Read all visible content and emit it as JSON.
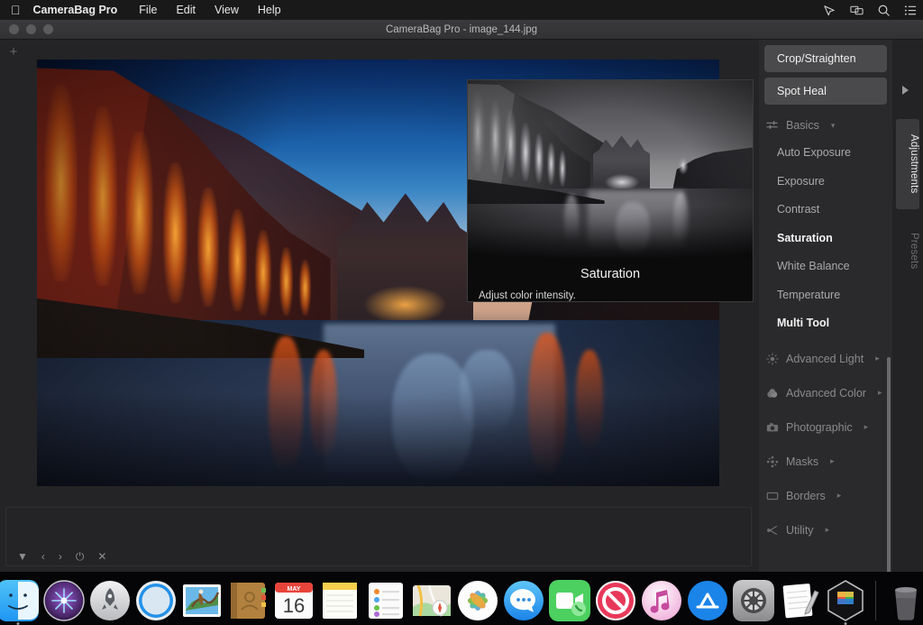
{
  "menubar": {
    "apple_icon": "apple-logo-icon",
    "app_name": "CameraBag Pro",
    "items": [
      "File",
      "Edit",
      "View",
      "Help"
    ],
    "status_icons": [
      "pointer-icon",
      "screen-sharing-icon",
      "search-icon",
      "control-center-icon"
    ]
  },
  "window": {
    "title": "CameraBag Pro - image_144.jpg",
    "traffic_lights": [
      "close",
      "minimize",
      "zoom"
    ]
  },
  "workspace": {
    "add_label": "+",
    "image_name": "image_144.jpg"
  },
  "filmstrip": {
    "tools": [
      {
        "name": "dropdown-toggle",
        "glyph": "▼"
      },
      {
        "name": "previous-image",
        "glyph": "‹"
      },
      {
        "name": "next-image",
        "glyph": "›"
      },
      {
        "name": "power-toggle",
        "glyph": "⏻"
      },
      {
        "name": "close-image",
        "glyph": "✕"
      }
    ]
  },
  "sidebar": {
    "tools": [
      {
        "label": "Crop/Straighten"
      },
      {
        "label": "Spot Heal"
      }
    ],
    "sections": [
      {
        "label": "Basics",
        "icon": "sliders-icon",
        "expanded": true,
        "caret": "▾",
        "items": [
          {
            "label": "Auto Exposure",
            "highlighted": false
          },
          {
            "label": "Exposure",
            "highlighted": false
          },
          {
            "label": "Contrast",
            "highlighted": false
          },
          {
            "label": "Saturation",
            "highlighted": true
          },
          {
            "label": "White Balance",
            "highlighted": false
          },
          {
            "label": "Temperature",
            "highlighted": false
          },
          {
            "label": "Multi Tool",
            "highlighted": true
          }
        ]
      },
      {
        "label": "Advanced Light",
        "icon": "sun-icon",
        "expanded": false,
        "caret": "▸",
        "items": []
      },
      {
        "label": "Advanced Color",
        "icon": "color-drop-icon",
        "expanded": false,
        "caret": "▸",
        "items": []
      },
      {
        "label": "Photographic",
        "icon": "camera-icon",
        "expanded": false,
        "caret": "▸",
        "items": []
      },
      {
        "label": "Masks",
        "icon": "masks-icon",
        "expanded": false,
        "caret": "▸",
        "items": []
      },
      {
        "label": "Borders",
        "icon": "border-icon",
        "expanded": false,
        "caret": "▸",
        "items": []
      },
      {
        "label": "Utility",
        "icon": "utility-icon",
        "expanded": false,
        "caret": "▸",
        "items": []
      }
    ]
  },
  "rail": {
    "collapse_glyph": "▶",
    "tabs": [
      {
        "label": "Adjustments",
        "active": true
      },
      {
        "label": "Presets",
        "active": false
      }
    ]
  },
  "tooltip": {
    "title": "Saturation",
    "description": "Adjust color intensity.",
    "preview_alt": "desaturated-preview"
  },
  "dock": {
    "items": [
      {
        "name": "finder",
        "running": true
      },
      {
        "name": "siri",
        "running": false
      },
      {
        "name": "launchpad",
        "running": false
      },
      {
        "name": "safari",
        "running": false
      },
      {
        "name": "mail",
        "running": false
      },
      {
        "name": "contacts",
        "running": false
      },
      {
        "name": "calendar",
        "running": false,
        "month": "MAY",
        "day": "16"
      },
      {
        "name": "notes",
        "running": false
      },
      {
        "name": "reminders",
        "running": false
      },
      {
        "name": "maps",
        "running": false
      },
      {
        "name": "photos",
        "running": false
      },
      {
        "name": "messages",
        "running": false
      },
      {
        "name": "facetime",
        "running": false
      },
      {
        "name": "do-not-disturb",
        "running": false
      },
      {
        "name": "itunes",
        "running": false
      },
      {
        "name": "app-store",
        "running": false
      },
      {
        "name": "system-preferences",
        "running": false
      },
      {
        "name": "textedit",
        "running": false
      },
      {
        "name": "camerabag-pro",
        "running": true
      },
      {
        "name": "trash",
        "running": false
      }
    ]
  },
  "colors": {
    "menubar_bg": "#191919",
    "window_bg": "#242426",
    "sidebar_bg": "#2a2a2c",
    "tool_button_bg": "#4a4a4c",
    "tab_active_bg": "#3a3a3c",
    "tooltip_bg": "#0b0b0b",
    "text_primary": "#f0f0f0",
    "text_muted": "#8a8a8c",
    "dock_bg": "#050507"
  }
}
